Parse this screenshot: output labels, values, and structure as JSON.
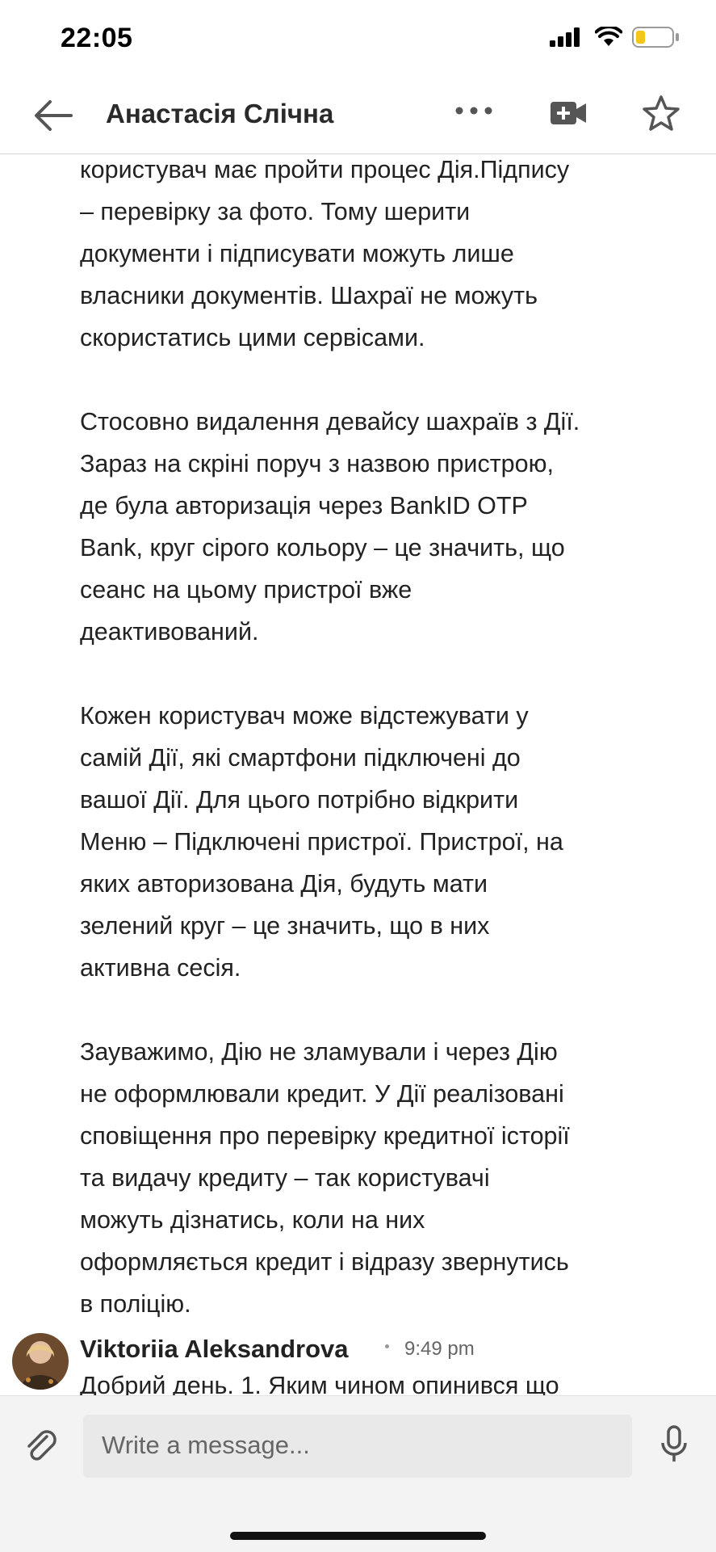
{
  "status": {
    "time": "22:05",
    "icons": [
      "signal-icon",
      "wifi-icon",
      "battery-low-icon"
    ],
    "battery_color": "#f5c518"
  },
  "header": {
    "title": "Анастасія Слічна",
    "icons": [
      "back-arrow-icon",
      "more-icon",
      "video-call-icon",
      "star-icon"
    ]
  },
  "message": {
    "paragraphs": [
      "користувач має пройти процес Дія.Підпису\n– перевірку за фото. Тому шерити\nдокументи і підписувати можуть лише\nвласники документів. Шахраї не можуть\nскористатись цими сервісами.",
      "Стосовно видалення девайсу шахраїв з Дії.\nЗараз на скріні поруч з назвою пристрою,\nде була авторизація через BankID OTP\nBank, круг сірого кольору – це значить, що\nсеанс на цьому пристрої вже\nдеактивований.",
      "Кожен користувач може відстежувати у\nсамій Дії, які смартфони підключені до\nвашої Дії. Для цього потрібно відкрити\nМеню – Підключені пристрої. Пристрої, на\nяких авторизована Дія, будуть мати\nзелений круг – це значить, що в них\nактивна сесія.",
      "Зауважимо, Дію не зламували і через Дію\nне оформлювали кредит. У Дії реалізовані\nсповіщення про перевірку кредитної історії\nта видачу кредиту – так користувачі\nможуть дізнатись, коли на них\nоформляється кредит і відразу звернутись\nв поліцію."
    ]
  },
  "sender": {
    "name": "Viktoriia Aleksandrova",
    "time": "9:49 pm",
    "preview": "Добрий день. 1. Яким чином опинився що"
  },
  "composer": {
    "placeholder": "Write a message...",
    "icons": [
      "attachment-icon",
      "microphone-icon"
    ]
  }
}
